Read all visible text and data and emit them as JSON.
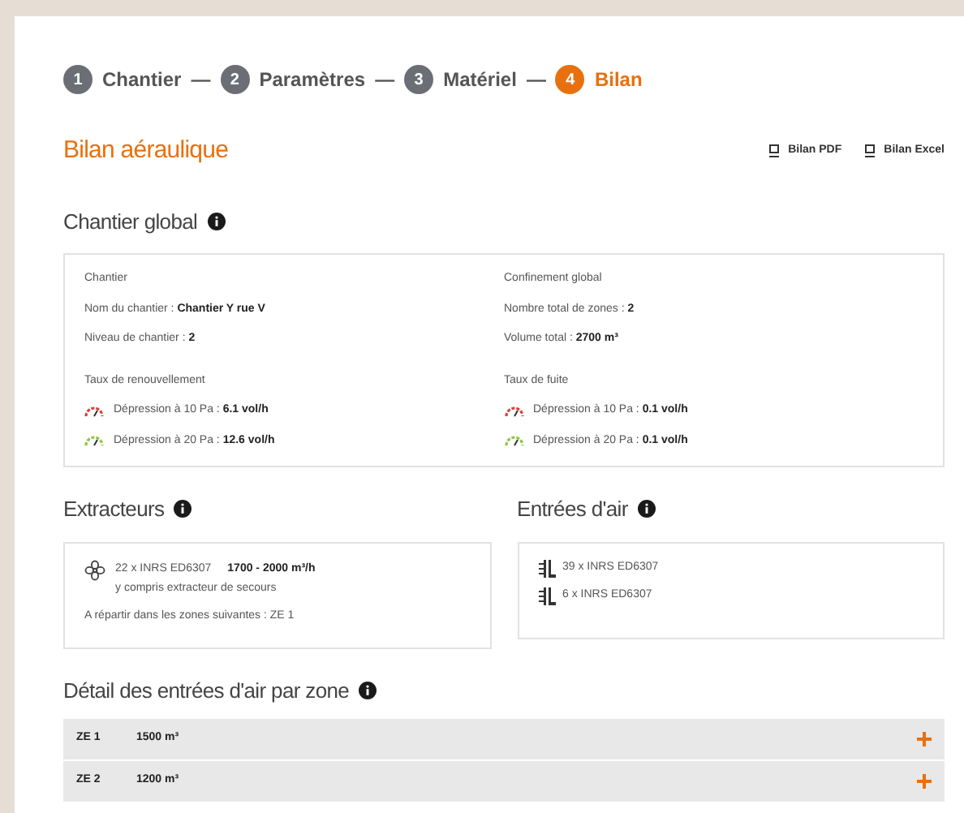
{
  "steps": [
    {
      "number": "1",
      "label": "Chantier",
      "selected": false
    },
    {
      "number": "2",
      "label": "Paramètres",
      "selected": false
    },
    {
      "number": "3",
      "label": "Matériel",
      "selected": false
    },
    {
      "number": "4",
      "label": "Bilan",
      "selected": true
    }
  ],
  "step_separator": "—",
  "title": "Bilan aéraulique",
  "downloads": [
    {
      "label": "Bilan PDF"
    },
    {
      "label": "Bilan Excel"
    }
  ],
  "chantier_global": {
    "heading": "Chantier global",
    "columns": [
      {
        "title": "Chantier",
        "fields": [
          {
            "label": "Nom du chantier : ",
            "value": "Chantier Y rue V"
          },
          {
            "label": "Niveau de chantier : ",
            "value": "2"
          }
        ],
        "rate_title": "Taux de renouvellement",
        "rates": [
          {
            "label": "Dépression à 10 Pa : ",
            "value": "6.1 vol/h",
            "color": "#d9403a"
          },
          {
            "label": "Dépression à 20 Pa : ",
            "value": "12.6 vol/h",
            "color": "#8cc63f"
          }
        ]
      },
      {
        "title": "Confinement global",
        "fields": [
          {
            "label": "Nombre total de zones : ",
            "value": "2"
          },
          {
            "label": "Volume total : ",
            "value": "2700 m³"
          }
        ],
        "rate_title": "Taux de fuite",
        "rates": [
          {
            "label": "Dépression à 10 Pa : ",
            "value": "0.1 vol/h",
            "color": "#d9403a"
          },
          {
            "label": "Dépression à 20 Pa : ",
            "value": "0.1 vol/h",
            "color": "#8cc63f"
          }
        ]
      }
    ]
  },
  "extracteurs": {
    "heading": "Extracteurs",
    "count": "22 x INRS ED6307",
    "flow": "1700 - 2000 m³/h",
    "note": "y compris extracteur de secours",
    "zones": "A répartir dans les zones suivantes : ZE 1"
  },
  "entrees_air": {
    "heading": "Entrées d'air",
    "items": [
      {
        "text": "39 x INRS ED6307"
      },
      {
        "text": "6 x INRS ED6307"
      }
    ]
  },
  "detail": {
    "heading": "Détail des entrées d'air par zone",
    "zones": [
      {
        "name": "ZE 1",
        "volume": "1500 m³",
        "expanded": false
      },
      {
        "name": "ZE 2",
        "volume": "1200 m³",
        "expanded": false
      }
    ]
  }
}
